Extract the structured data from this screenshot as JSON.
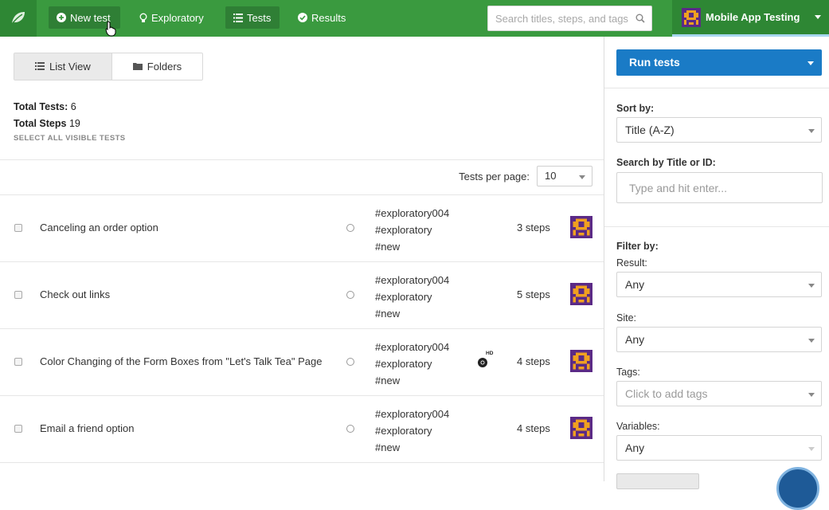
{
  "topbar": {
    "new_test": "New test",
    "exploratory": "Exploratory",
    "tests": "Tests",
    "results": "Results",
    "search_placeholder": "Search titles, steps, and tags",
    "project_name": "Mobile App Testing"
  },
  "view": {
    "list_view": "List View",
    "folders": "Folders"
  },
  "stats": {
    "total_tests_label": "Total Tests:",
    "total_tests_value": "6",
    "total_steps_label": "Total Steps",
    "total_steps_value": "19",
    "select_all": "SELECT ALL VISIBLE TESTS"
  },
  "pagination": {
    "per_page_label": "Tests per page:",
    "per_page_value": "10"
  },
  "tests": [
    {
      "title": "Canceling an order option",
      "tags": [
        "#exploratory004",
        "#exploratory",
        "#new"
      ],
      "steps": "3 steps",
      "browser": ""
    },
    {
      "title": "Check out links",
      "tags": [
        "#exploratory004",
        "#exploratory",
        "#new"
      ],
      "steps": "5 steps",
      "browser": ""
    },
    {
      "title": "Color Changing of the Form Boxes from \"Let's Talk Tea\" Page",
      "tags": [
        "#exploratory004",
        "#exploratory",
        "#new"
      ],
      "steps": "4 steps",
      "browser": "HD"
    },
    {
      "title": "Email a friend option",
      "tags": [
        "#exploratory004",
        "#exploratory",
        "#new"
      ],
      "steps": "4 steps",
      "browser": ""
    }
  ],
  "sidebar": {
    "run_tests": "Run tests",
    "sort_by_label": "Sort by:",
    "sort_by_value": "Title (A-Z)",
    "search_label": "Search by Title or ID:",
    "search_placeholder": "Type and hit enter...",
    "filter_by_label": "Filter by:",
    "result_label": "Result:",
    "result_value": "Any",
    "site_label": "Site:",
    "site_value": "Any",
    "tags_label": "Tags:",
    "tags_placeholder": "Click to add tags",
    "variables_label": "Variables:",
    "variables_value": "Any"
  },
  "colors": {
    "topbar": "#3a9a3f",
    "accent_blue": "#1a7bc6",
    "avatar_purple": "#5b2a86",
    "avatar_orange": "#f0a020"
  },
  "icons": [
    "leaf-icon",
    "plus-circle-icon",
    "lightbulb-icon",
    "list-icon",
    "check-circle-icon",
    "search-icon",
    "folder-icon",
    "chrome-icon"
  ]
}
